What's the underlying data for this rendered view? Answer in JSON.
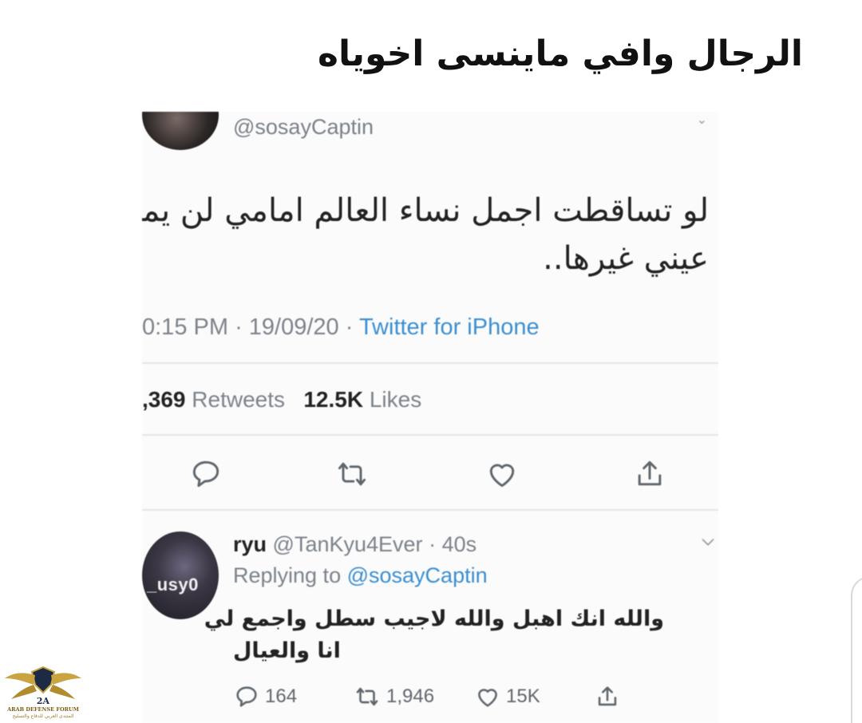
{
  "caption": "الرجال وافي ماينسى اخوياه",
  "tweet": {
    "handle": "@sosayCaptin",
    "text_line1": "لو تساقطت اجمل نساء العالم امامي لن يملي",
    "text_line2": "عيني غيرها..",
    "time": "0:15 PM",
    "date": "19/09/20",
    "source": "Twitter for iPhone",
    "retweets_count": ",369",
    "retweets_label": "Retweets",
    "likes_count": "12.5K",
    "likes_label": "Likes"
  },
  "reply": {
    "name": "ryu",
    "handle": "@TanKyu4Ever",
    "age": "40s",
    "replying_label": "Replying to",
    "replying_to": "@sosayCaptin",
    "avatar_text": "_usy0",
    "text_line1": "والله انك اهبل والله لاجيب سطل واجمع لي",
    "text_line2": "انا والعيال",
    "replies": "164",
    "retweets": "1,946",
    "likes": "15K"
  },
  "watermark": {
    "name": "ARAB DEFENSE FORUM",
    "arabic": "المنتدى العربي للدفاع والتسليح",
    "badge": "2A"
  },
  "colors": {
    "link": "#3b8fd1",
    "muted": "#7c838b",
    "divider": "#e4e6e8"
  }
}
